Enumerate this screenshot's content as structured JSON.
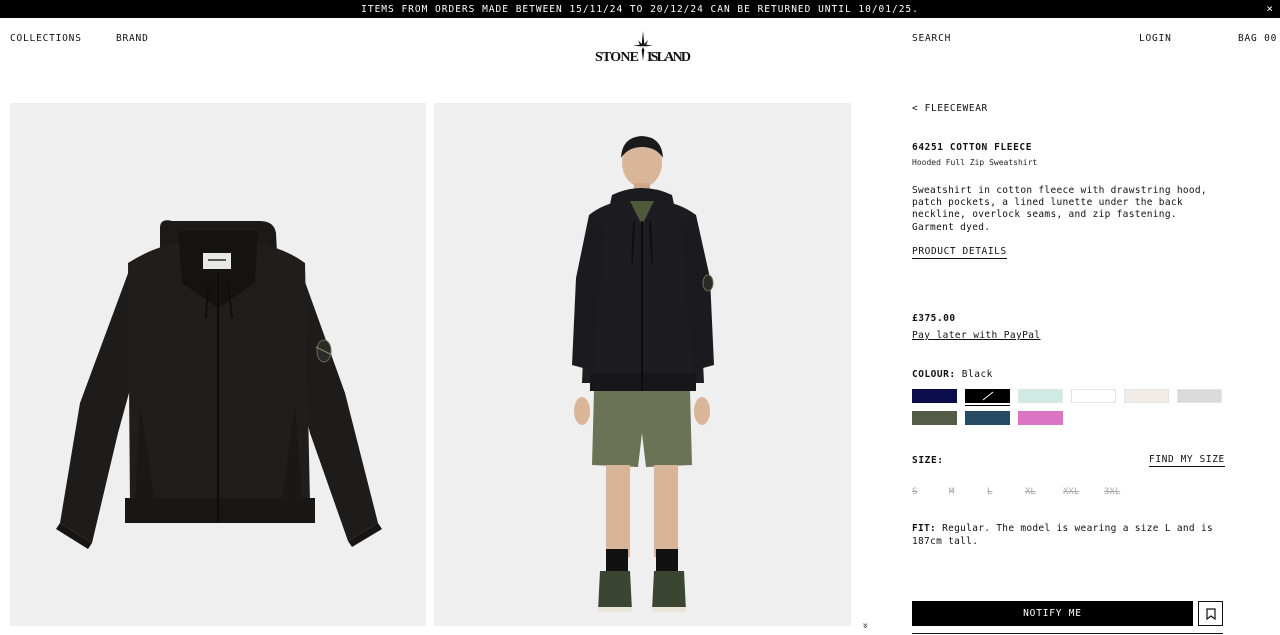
{
  "announcement": {
    "text": "ITEMS FROM ORDERS MADE BETWEEN 15/11/24 TO 20/12/24 CAN BE RETURNED UNTIL 10/01/25.",
    "close_icon": "×"
  },
  "header": {
    "collections": "COLLECTIONS",
    "brand": "BRAND",
    "logo": "STONE ISLAND",
    "search": "SEARCH",
    "login": "LOGIN",
    "bag": "BAG 00"
  },
  "gallery": {
    "scroll_icon": "chevron-double-down-icon",
    "scroll_glyph": "»"
  },
  "product": {
    "breadcrumb": "< FLEECEWEAR",
    "code": "64251 COTTON FLEECE",
    "subtitle": "Hooded Full Zip Sweatshirt",
    "description": "Sweatshirt in cotton fleece with drawstring hood, patch pockets, a lined lunette under the back neckline, overlock seams, and zip fastening. Garment dyed.",
    "details_link": "PRODUCT DETAILS",
    "price": "£375.00",
    "paypal": "Pay later with PayPal",
    "colour_label": "COLOUR:",
    "colour_value": "Black",
    "swatches": [
      {
        "color": "#0b0c4a"
      },
      {
        "color": "#000000"
      },
      {
        "color": "#cfe9e3"
      },
      {
        "color": "#ffffff"
      },
      {
        "color": "#f1ede6"
      },
      {
        "color": "#dadada"
      },
      {
        "color": "#545b47"
      },
      {
        "color": "#254a62"
      },
      {
        "color": "#dc74c4"
      }
    ],
    "size_label": "SIZE:",
    "find_size": "FIND MY SIZE",
    "sizes": [
      "S",
      "M",
      "L",
      "XL",
      "XXL",
      "3XL"
    ],
    "fit_label": "FIT:",
    "fit_text": "Regular. The model is wearing a size L and is 187cm tall.",
    "notify": "NOTIFY ME",
    "wishlist_icon": "bookmark-icon"
  }
}
